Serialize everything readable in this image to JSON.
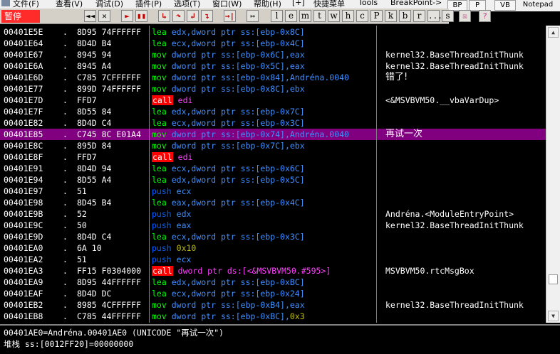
{
  "menu": {
    "items": [
      "文件(F)",
      "查看(V)",
      "调试(D)",
      "插件(P)",
      "选项(T)",
      "窗口(W)",
      "帮助(H)",
      "[+]",
      "快捷菜单",
      "Tools",
      "BreakPoint->"
    ]
  },
  "right_tabs": [
    "BP",
    "P",
    "VB",
    "Notepad"
  ],
  "toolbar": {
    "pause_label": "暂停",
    "buttons": [
      "◄◄",
      "✕",
      "►",
      "▮▮",
      "↳",
      "↷",
      "↲",
      "↴",
      "→|",
      "↦",
      "l",
      "e",
      "m",
      "t",
      "w",
      "h",
      "c",
      "P",
      "k",
      "b",
      "r",
      "...",
      "s"
    ]
  },
  "disassembly": {
    "rows": [
      {
        "addr": "00401E5E",
        "mark": ".",
        "hex": "8D95 74FFFFFF",
        "ins": "lea",
        "ops": "edx,dword ptr ss:[ebp-0x8C]",
        "comment": ""
      },
      {
        "addr": "00401E64",
        "mark": ".",
        "hex": "8D4D B4",
        "ins": "lea",
        "ops": "ecx,dword ptr ss:[ebp-0x4C]",
        "comment": ""
      },
      {
        "addr": "00401E67",
        "mark": ".",
        "hex": "8945 94",
        "ins": "mov",
        "ops": "dword ptr ss:[ebp-0x6C],eax",
        "comment": "kernel32.BaseThreadInitThunk"
      },
      {
        "addr": "00401E6A",
        "mark": ".",
        "hex": "8945 A4",
        "ins": "mov",
        "ops": "dword ptr ss:[ebp-0x5C],eax",
        "comment": "kernel32.BaseThreadInitThunk"
      },
      {
        "addr": "00401E6D",
        "mark": ".",
        "hex": "C785 7CFFFFFF",
        "ins": "mov",
        "ops": "dword ptr ss:[ebp-0x84],Andréna.0040",
        "comment": "错了!"
      },
      {
        "addr": "00401E77",
        "mark": ".",
        "hex": "899D 74FFFFFF",
        "ins": "mov",
        "ops": "dword ptr ss:[ebp-0x8C],ebx",
        "comment": ""
      },
      {
        "addr": "00401E7D",
        "mark": ".",
        "hex": "FFD7",
        "ins": "call",
        "ops": "edi",
        "comment": "<&MSVBVM50.__vbaVarDup>"
      },
      {
        "addr": "00401E7F",
        "mark": ".",
        "hex": "8D55 84",
        "ins": "lea",
        "ops": "edx,dword ptr ss:[ebp-0x7C]",
        "comment": ""
      },
      {
        "addr": "00401E82",
        "mark": ".",
        "hex": "8D4D C4",
        "ins": "lea",
        "ops": "ecx,dword ptr ss:[ebp-0x3C]",
        "comment": ""
      },
      {
        "addr": "00401E85",
        "mark": ".",
        "hex": "C745 8C E01A4",
        "ins": "mov",
        "ops": "dword ptr ss:[ebp-0x74],Andréna.0040",
        "comment": "再试一次",
        "selected": true
      },
      {
        "addr": "00401E8C",
        "mark": ".",
        "hex": "895D 84",
        "ins": "mov",
        "ops": "dword ptr ss:[ebp-0x7C],ebx",
        "comment": ""
      },
      {
        "addr": "00401E8F",
        "mark": ".",
        "hex": "FFD7",
        "ins": "call",
        "ops": "edi",
        "comment": ""
      },
      {
        "addr": "00401E91",
        "mark": ".",
        "hex": "8D4D 94",
        "ins": "lea",
        "ops": "ecx,dword ptr ss:[ebp-0x6C]",
        "comment": ""
      },
      {
        "addr": "00401E94",
        "mark": ".",
        "hex": "8D55 A4",
        "ins": "lea",
        "ops": "edx,dword ptr ss:[ebp-0x5C]",
        "comment": ""
      },
      {
        "addr": "00401E97",
        "mark": ".",
        "hex": "51",
        "ins": "push",
        "ops": "ecx",
        "comment": ""
      },
      {
        "addr": "00401E98",
        "mark": ".",
        "hex": "8D45 B4",
        "ins": "lea",
        "ops": "eax,dword ptr ss:[ebp-0x4C]",
        "comment": ""
      },
      {
        "addr": "00401E9B",
        "mark": ".",
        "hex": "52",
        "ins": "push",
        "ops": "edx",
        "comment": "Andréna.<ModuleEntryPoint>"
      },
      {
        "addr": "00401E9C",
        "mark": ".",
        "hex": "50",
        "ins": "push",
        "ops": "eax",
        "comment": "kernel32.BaseThreadInitThunk"
      },
      {
        "addr": "00401E9D",
        "mark": ".",
        "hex": "8D4D C4",
        "ins": "lea",
        "ops": "ecx,dword ptr ss:[ebp-0x3C]",
        "comment": ""
      },
      {
        "addr": "00401EA0",
        "mark": ".",
        "hex": "6A 10",
        "ins": "push",
        "ops": "0x10",
        "comment": ""
      },
      {
        "addr": "00401EA2",
        "mark": ".",
        "hex": "51",
        "ins": "push",
        "ops": "ecx",
        "comment": ""
      },
      {
        "addr": "00401EA3",
        "mark": ".",
        "hex": "FF15 F0304000",
        "ins": "call",
        "ops": "dword ptr ds:[<&MSVBVM50.#595>]",
        "comment": "MSVBVM50.rtcMsgBox"
      },
      {
        "addr": "00401EA9",
        "mark": ".",
        "hex": "8D95 44FFFFFF",
        "ins": "lea",
        "ops": "edx,dword ptr ss:[ebp-0xBC]",
        "comment": ""
      },
      {
        "addr": "00401EAF",
        "mark": ".",
        "hex": "8D4D DC",
        "ins": "lea",
        "ops": "ecx,dword ptr ss:[ebp-0x24]",
        "comment": ""
      },
      {
        "addr": "00401EB2",
        "mark": ".",
        "hex": "8985 4CFFFFFF",
        "ins": "mov",
        "ops": "dword ptr ss:[ebp-0xB4],eax",
        "comment": "kernel32.BaseThreadInitThunk"
      },
      {
        "addr": "00401EB8",
        "mark": ".",
        "hex": "C785 44FFFFFF",
        "ins": "mov",
        "ops": "dword ptr ss:[ebp-0xBC],0x3",
        "comment": ""
      }
    ]
  },
  "info": {
    "line1": "00401AE0=Andréna.00401AE0 (UNICODE \"再试一次\")",
    "line2": "堆栈 ss:[0012FF20]=00000000"
  },
  "colors": {
    "selected_row": "#800080",
    "call_bg": "#ff0000",
    "pause_bg": "#ff2a2a"
  }
}
